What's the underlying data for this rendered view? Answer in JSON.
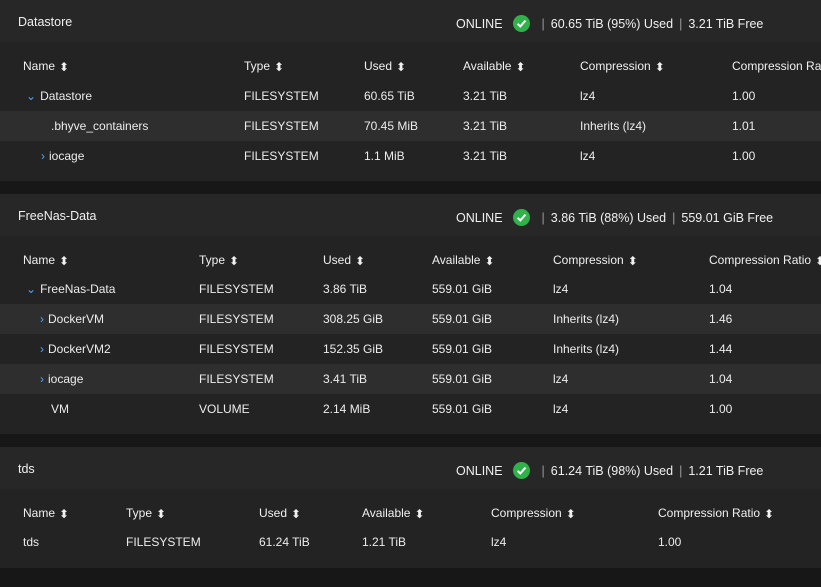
{
  "colors": {
    "status_ok": "#2fb24a",
    "expander": "#4aa6ff",
    "row_alt": "#2e2e2e",
    "background": "#171717"
  },
  "pools": [
    {
      "name": "Datastore",
      "status": "ONLINE",
      "used": "60.65 TiB (95%) Used",
      "free": "3.21 TiB Free",
      "columns": [
        "Name",
        "Type",
        "Used",
        "Available",
        "Compression",
        "Compression Ratio"
      ],
      "rows": [
        {
          "name": "Datastore",
          "expander": "down",
          "type": "FILESYSTEM",
          "used": "60.65 TiB",
          "available": "3.21 TiB",
          "compression": "lz4",
          "ratio": "1.00"
        },
        {
          "name": ".bhyve_containers",
          "expander": "",
          "type": "FILESYSTEM",
          "used": "70.45 MiB",
          "available": "3.21 TiB",
          "compression": "Inherits (lz4)",
          "ratio": "1.01"
        },
        {
          "name": "iocage",
          "expander": "right",
          "type": "FILESYSTEM",
          "used": "1.1 MiB",
          "available": "3.21 TiB",
          "compression": "lz4",
          "ratio": "1.00"
        }
      ]
    },
    {
      "name": "FreeNas-Data",
      "status": "ONLINE",
      "used": "3.86 TiB (88%) Used",
      "free": "559.01 GiB Free",
      "columns": [
        "Name",
        "Type",
        "Used",
        "Available",
        "Compression",
        "Compression Ratio"
      ],
      "rows": [
        {
          "name": "FreeNas-Data",
          "expander": "down",
          "type": "FILESYSTEM",
          "used": "3.86 TiB",
          "available": "559.01 GiB",
          "compression": "lz4",
          "ratio": "1.04"
        },
        {
          "name": "DockerVM",
          "expander": "right",
          "type": "FILESYSTEM",
          "used": "308.25 GiB",
          "available": "559.01 GiB",
          "compression": "Inherits (lz4)",
          "ratio": "1.46"
        },
        {
          "name": "DockerVM2",
          "expander": "right",
          "type": "FILESYSTEM",
          "used": "152.35 GiB",
          "available": "559.01 GiB",
          "compression": "Inherits (lz4)",
          "ratio": "1.44"
        },
        {
          "name": "iocage",
          "expander": "right",
          "type": "FILESYSTEM",
          "used": "3.41 TiB",
          "available": "559.01 GiB",
          "compression": "lz4",
          "ratio": "1.04"
        },
        {
          "name": "VM",
          "expander": "",
          "type": "VOLUME",
          "used": "2.14 MiB",
          "available": "559.01 GiB",
          "compression": "lz4",
          "ratio": "1.00"
        }
      ]
    },
    {
      "name": "tds",
      "status": "ONLINE",
      "used": "61.24 TiB (98%) Used",
      "free": "1.21 TiB Free",
      "columns": [
        "Name",
        "Type",
        "Used",
        "Available",
        "Compression",
        "Compression Ratio"
      ],
      "rows": [
        {
          "name": "tds",
          "expander": "",
          "type": "FILESYSTEM",
          "used": "61.24 TiB",
          "available": "1.21 TiB",
          "compression": "lz4",
          "ratio": "1.00"
        }
      ]
    }
  ]
}
